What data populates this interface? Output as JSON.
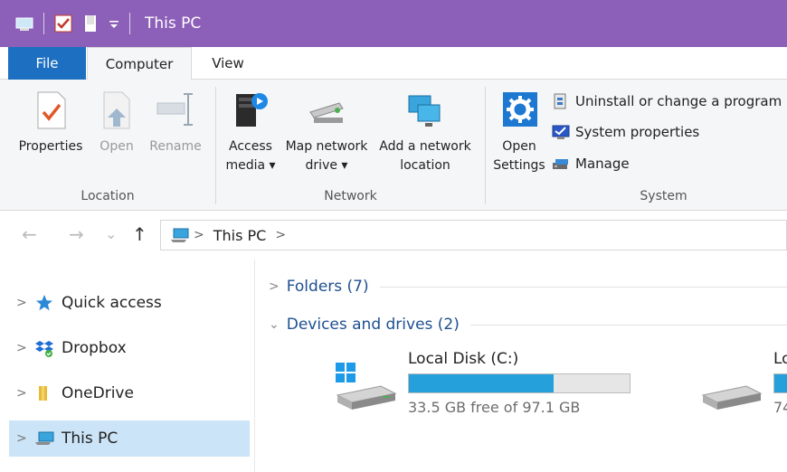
{
  "window": {
    "title": "This PC",
    "accent_color": "#8c5fb8"
  },
  "ribbon_tabs": {
    "file": "File",
    "computer": "Computer",
    "view": "View"
  },
  "ribbon": {
    "location": {
      "label": "Location",
      "properties": "Properties",
      "open": "Open",
      "rename": "Rename"
    },
    "network": {
      "label": "Network",
      "access_media_1": "Access",
      "access_media_2": "media ▾",
      "map_drive_1": "Map network",
      "map_drive_2": "drive ▾",
      "add_location_1": "Add a network",
      "add_location_2": "location"
    },
    "system": {
      "label": "System",
      "open_settings_1": "Open",
      "open_settings_2": "Settings",
      "uninstall": "Uninstall or change a program",
      "system_properties": "System properties",
      "manage": "Manage"
    }
  },
  "address": {
    "back": "←",
    "forward": "→",
    "recent": "⌄",
    "up": "↑",
    "sep1": ">",
    "location": "This PC",
    "sep2": ">"
  },
  "navpane": {
    "items": [
      {
        "label": "Quick access",
        "caret": ">"
      },
      {
        "label": "Dropbox",
        "caret": ">"
      },
      {
        "label": "OneDrive",
        "caret": ">"
      },
      {
        "label": "This PC",
        "caret": ">"
      }
    ]
  },
  "content": {
    "folders": {
      "caret": ">",
      "label": "Folders (7)"
    },
    "devices": {
      "caret": "⌄",
      "label": "Devices and drives (2)"
    },
    "drives": [
      {
        "name": "Local Disk (C:)",
        "free": "33.5 GB free of 97.1 GB",
        "used_fraction": 0.655
      },
      {
        "name": "Lo",
        "free": "74",
        "used_fraction": 0.6
      }
    ]
  }
}
